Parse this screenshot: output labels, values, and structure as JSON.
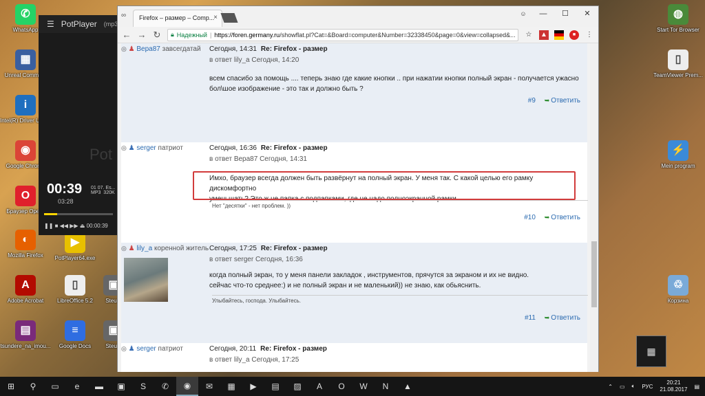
{
  "desktop": {
    "left_icons": [
      {
        "label": "WhatsApp",
        "icon": "whatsapp-icon",
        "color": "#25d366",
        "glyph": "✆"
      },
      {
        "label": "Unreal Comma...",
        "icon": "unreal-commander-icon",
        "color": "#3a5fa0",
        "glyph": "▦"
      },
      {
        "label": "Intel(R) Driver Update Utility 2",
        "icon": "intel-icon",
        "color": "#1f6fbf",
        "glyph": "i"
      },
      {
        "label": "Google Chrome",
        "icon": "chrome-icon",
        "color": "#db4437",
        "glyph": "◉"
      },
      {
        "label": "Браузер Opera",
        "icon": "opera-icon",
        "color": "#e0202c",
        "glyph": "O"
      },
      {
        "label": "Mozilla Firefox",
        "icon": "firefox-icon",
        "color": "#e66000",
        "glyph": "◐"
      },
      {
        "label": "Adobe Acrobat",
        "icon": "acrobat-icon",
        "color": "#b30b00",
        "glyph": "A"
      },
      {
        "label": "tsundere_na_imou...",
        "icon": "winrar-icon",
        "color": "#7a2a7a",
        "glyph": "▤"
      }
    ],
    "second_icons": [
      {
        "label": "PotPlayer64.exe",
        "icon": "potplayer-icon",
        "color": "#e8c000",
        "glyph": "▶"
      },
      {
        "label": "LibreOffice 5.2",
        "icon": "libreoffice-icon",
        "color": "#eeeeee",
        "glyph": "▯"
      },
      {
        "label": "Google Docs",
        "icon": "google-docs-icon",
        "color": "#2f6de1",
        "glyph": "≡"
      }
    ],
    "third_icons": [
      {
        "label": "Steuer",
        "icon": "steuer-icon",
        "color": "#666666",
        "glyph": "▣"
      },
      {
        "label": "Steu...",
        "icon": "steuer-icon",
        "color": "#666666",
        "glyph": "▣"
      }
    ],
    "right_icons": [
      {
        "label": "Start Tor Browser",
        "icon": "tor-icon",
        "color": "#4a8a3a",
        "glyph": "◍"
      },
      {
        "label": "TeamViewer Prem...",
        "icon": "teamviewer-icon",
        "color": "#eeeeee",
        "glyph": "▯"
      },
      {
        "label": "Mein program",
        "icon": "program-icon",
        "color": "#3a8ad8",
        "glyph": "⚡"
      },
      {
        "label": "Корзина",
        "icon": "recycle-bin-icon",
        "color": "#7aaad8",
        "glyph": "♲"
      }
    ]
  },
  "potplayer": {
    "title": "PotPlayer",
    "format": "(mp3)",
    "time": "00:39",
    "total": "03:28",
    "track": "01 07. Es...",
    "codec": "MP3",
    "bitrate": "320K",
    "position": "00:00:39",
    "progress": 0.19,
    "watermark": "Pot"
  },
  "browser": {
    "tab_title": "Firefox – размер – Comp...",
    "window_user": "☺",
    "secure_label": "Надежный",
    "url_host": "https://foren.germany.ru",
    "url_path": "/showflat.pl?Cat=&Board=computer&Number=32338450&page=0&view=collapsed&..."
  },
  "posts": [
    {
      "author": "Вера87",
      "rank": "завсегдатай",
      "date": "Сегодня, 14:31",
      "subject": "Re: Firefox - размер",
      "reply_prefix": "в ответ",
      "reply_to": "lily_a",
      "reply_date": "Сегодня, 14:20",
      "lines": [
        "всем спасибо за помощь .... теперь знаю где какие кнопки .. при нажатии кнопки полный экран - получается ужасно",
        "бол\\шое изображение - это так и должно быть ?"
      ],
      "signature": "",
      "number": "#9",
      "answer": "Ответить"
    },
    {
      "author": "serger",
      "rank": "патриот",
      "date": "Сегодня, 16:36",
      "subject": "Re: Firefox - размер",
      "reply_prefix": "в ответ",
      "reply_to": "Вера87",
      "reply_date": "Сегодня, 14:31",
      "lines": [
        "Имхо, браузер всегда должен быть развёрнут на полный экран. У меня так. С какой целью его рамку дискомфортно",
        "уменьшать? Это ж не папка с подпапками, где не надо полноэкранной рамки."
      ],
      "signature": "Нет \"десятки\" - нет проблем. ))",
      "number": "#10",
      "answer": "Ответить"
    },
    {
      "author": "lily_a",
      "rank": "коренной житель",
      "date": "Сегодня, 17:25",
      "subject": "Re: Firefox - размер",
      "reply_prefix": "в ответ",
      "reply_to": "serger",
      "reply_date": "Сегодня, 16:36",
      "lines": [
        "когда полный экран, то у меня панели закладок , инструментов, прячутся за экраном и их не видно.",
        "сейчас что-то среднее:) и не полный экран и не маленький)) не знаю, как обьяснить."
      ],
      "signature": "Улыбайтесь, господа. Улыбайтесь.",
      "number": "#11",
      "answer": "Ответить"
    },
    {
      "author": "serger",
      "rank": "патриот",
      "date": "Сегодня, 20:11",
      "subject": "Re: Firefox - размер",
      "reply_prefix": "в ответ",
      "reply_to": "lily_a",
      "reply_date": "Сегодня, 17:25"
    }
  ],
  "taskbar": {
    "apps": [
      "start-icon",
      "search-icon",
      "task-view-icon",
      "edge-icon",
      "explorer-icon",
      "store-icon",
      "skype-icon",
      "whatsapp-icon",
      "chrome-icon",
      "thunderbird-icon",
      "calculator-icon",
      "potplayer-icon",
      "calendar-icon",
      "photos-icon",
      "acrobat-icon",
      "opera-icon",
      "word-icon",
      "onenote-icon",
      "vlc-icon"
    ],
    "lang": "РУС",
    "time": "20:21",
    "date": "21.08.2017"
  }
}
